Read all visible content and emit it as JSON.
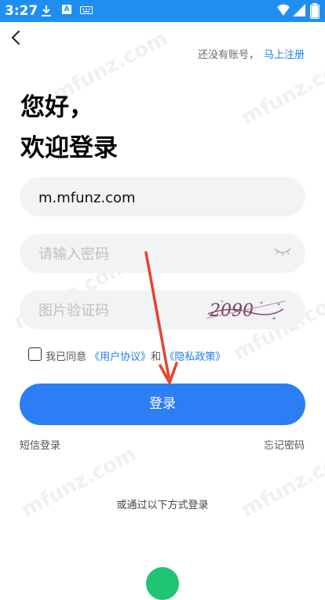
{
  "status_bar": {
    "time": "3:27",
    "icons": [
      "download-icon",
      "a-icon",
      "keyboard-icon",
      "wifi-icon",
      "signal-icon",
      "battery-icon"
    ],
    "a_icon_label": "A",
    "color": "#1f8ef1"
  },
  "header": {
    "back_icon": "back-chevron-icon",
    "no_account_text": "还没有账号，",
    "register_link": "马上注册"
  },
  "greeting": {
    "line1": "您好，",
    "line2": "欢迎登录"
  },
  "form": {
    "username_value": "m.mfunz.com",
    "password_placeholder": "请输入密码",
    "password_toggle_icon": "eye-closed-icon",
    "captcha_placeholder": "图片验证码",
    "captcha_image_text": "2090"
  },
  "agreement": {
    "checked": false,
    "prefix": "我已同意",
    "user_agreement": "《用户协议》",
    "and": "和",
    "privacy_policy": "《隐私政策》"
  },
  "login_button": "登录",
  "sms_login": "短信登录",
  "forgot_password": "忘记密码",
  "other_ways": "或通过以下方式登录",
  "watermark": "mfunz.com",
  "colors": {
    "accent": "#2b7ef3",
    "link": "#1f7ef0",
    "input_bg": "#f2f3f5",
    "wechat_green": "#1ec472",
    "annotation_arrow": "#e8432e"
  }
}
